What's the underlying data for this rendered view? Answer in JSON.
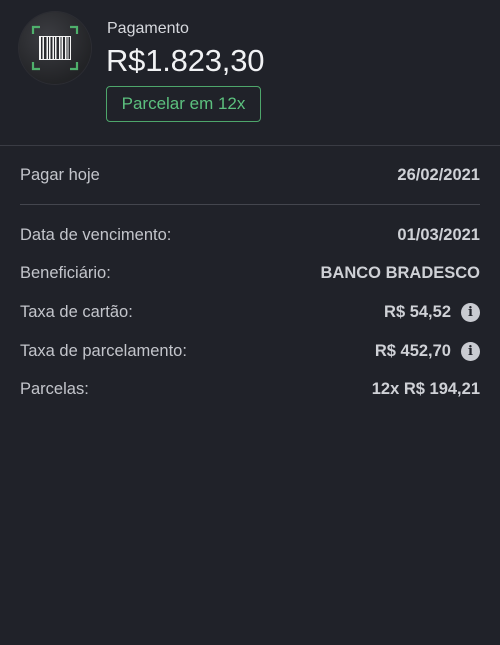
{
  "header": {
    "icon": "barcode-icon",
    "title": "Pagamento",
    "amount": "R$1.823,30",
    "installment_button": "Parcelar em 12x",
    "accent_color": "#5cc07e"
  },
  "pay_today": {
    "label": "Pagar hoje",
    "value": "26/02/2021"
  },
  "details": [
    {
      "label": "Data de vencimento:",
      "value": "01/03/2021"
    },
    {
      "label": "Beneficiário:",
      "value": "BANCO BRADESCO"
    },
    {
      "label": "Taxa de cartão:",
      "value": "R$ 54,52",
      "info_icon": "i"
    },
    {
      "label": "Taxa de parcelamento:",
      "value": "R$ 452,70",
      "info_icon": "i"
    },
    {
      "label": "Parcelas:",
      "value": "12x R$ 194,21"
    }
  ]
}
